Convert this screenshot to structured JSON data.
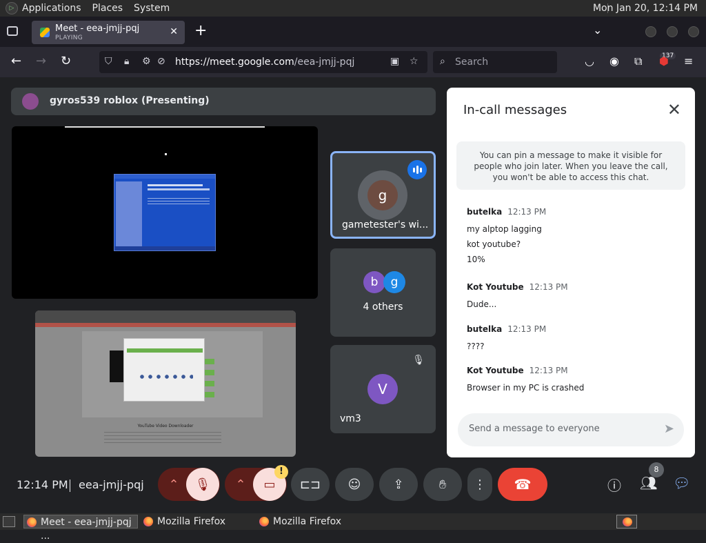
{
  "panel": {
    "applications": "Applications",
    "places": "Places",
    "system": "System",
    "clock": "Mon Jan 20, 12:14 PM"
  },
  "browser": {
    "tab_title": "Meet - eea-jmjj-pqj",
    "tab_status": "PLAYING",
    "url_host": "https://meet.google.com",
    "url_path": "/eea-jmjj-pqj",
    "search_placeholder": "Search",
    "extension_badge": "137"
  },
  "meet": {
    "presenter_label": "gyros539 roblox (Presenting)",
    "participants": [
      {
        "initial": "g",
        "name": "gametester's wi...",
        "color": "#6d4c41",
        "speaking": true
      },
      {
        "initials": [
          "b",
          "g"
        ],
        "colors": [
          "#7e57c2",
          "#1e88e5"
        ],
        "label": "4 others"
      },
      {
        "initial": "V",
        "name": "vm3",
        "color": "#7e57c2",
        "muted": true
      }
    ],
    "shared_caption": "YouTube Video Downloader"
  },
  "chat": {
    "title": "In-call messages",
    "pin_note": "You can pin a message to make it visible for people who join later. When you leave the call, you won't be able to access this chat.",
    "messages": [
      {
        "sender": "butelka",
        "time": "12:13 PM",
        "lines": [
          "my alptop lagging",
          "kot youtube?",
          "10%"
        ]
      },
      {
        "sender": "Kot Youtube",
        "time": "12:13 PM",
        "lines": [
          "Dude..."
        ]
      },
      {
        "sender": "butelka",
        "time": "12:13 PM",
        "lines": [
          "????"
        ]
      },
      {
        "sender": "Kot Youtube",
        "time": "12:13 PM",
        "lines": [
          "Browser in my PC is crashed"
        ]
      }
    ],
    "input_placeholder": "Send a message to everyone"
  },
  "controls": {
    "time": "12:14 PM",
    "meeting_code": "eea-jmjj-pqj",
    "warning_glyph": "!",
    "people_count": "8"
  },
  "taskbar": {
    "items": [
      "Meet - eea-jmjj-pqj ...",
      "Mozilla Firefox",
      "Mozilla Firefox"
    ]
  },
  "colors": {
    "accent_blue": "#8ab4f8",
    "end_call_red": "#ea4335",
    "muted_red": "#5c1e1a",
    "panel_bg": "#3c4043"
  }
}
